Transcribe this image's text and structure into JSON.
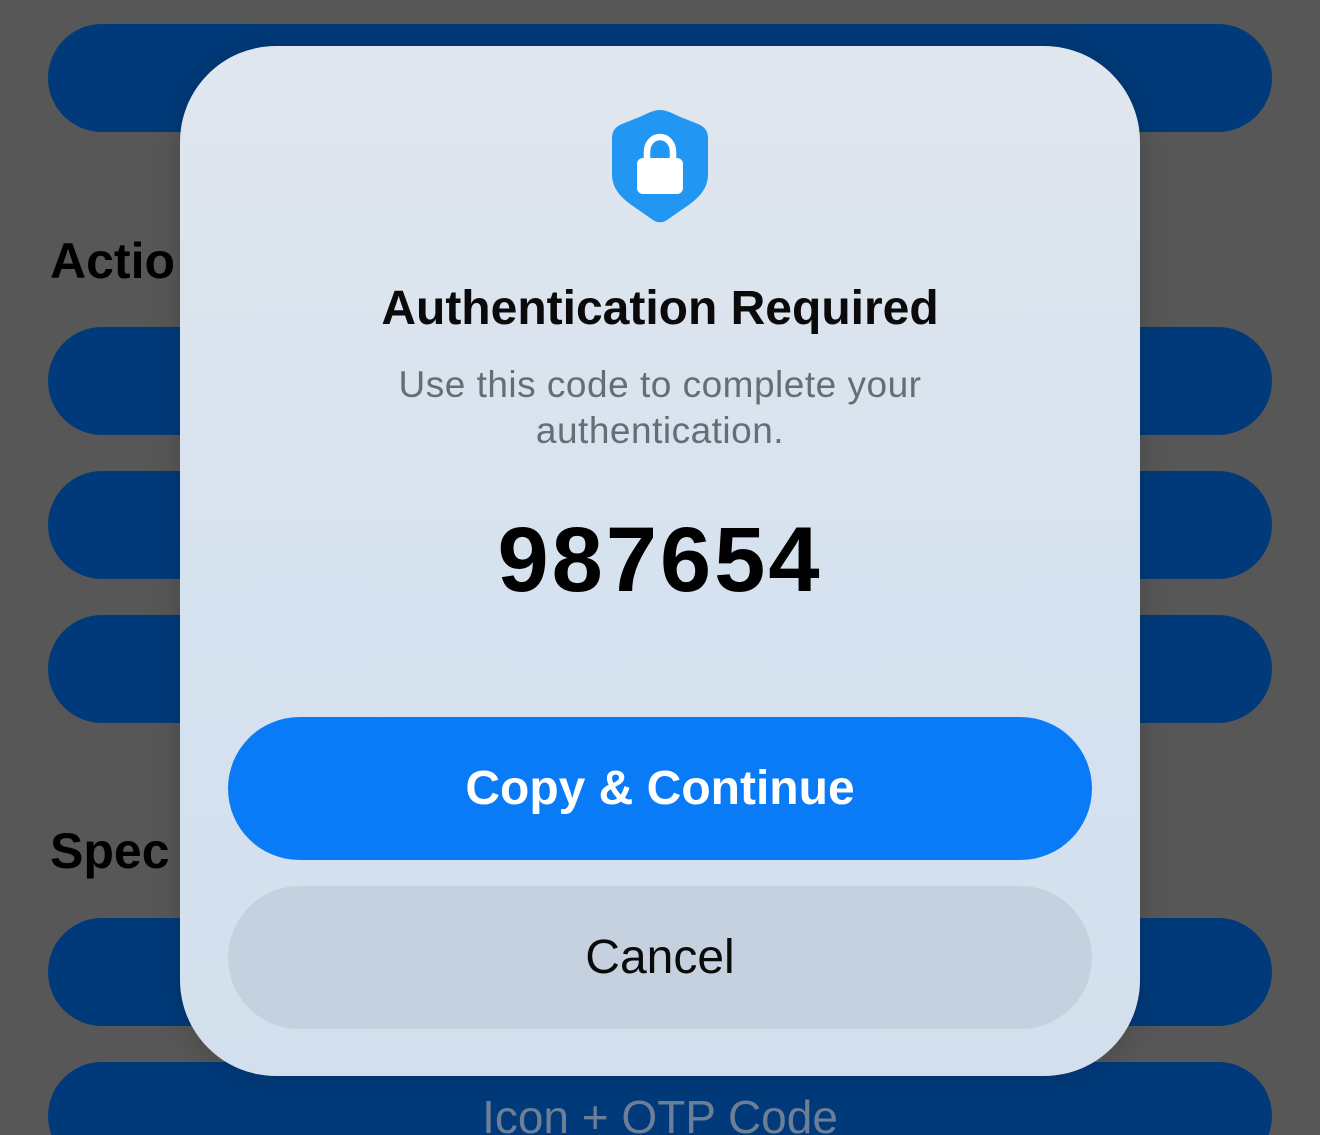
{
  "background": {
    "section_headings": [
      "Actio",
      "Spec"
    ],
    "bottom_button_label": "Icon + OTP Code"
  },
  "dialog": {
    "icon": "shield-lock-icon",
    "title": "Authentication Required",
    "message": "Use this code to complete your authentication.",
    "code": "987654",
    "primary_button_label": "Copy & Continue",
    "secondary_button_label": "Cancel"
  },
  "colors": {
    "overlay_background": "#575757",
    "background_button": "#003a7a",
    "accent": "#0a7bf6",
    "shield": "#2196f3",
    "secondary_button": "#c5d1de"
  }
}
